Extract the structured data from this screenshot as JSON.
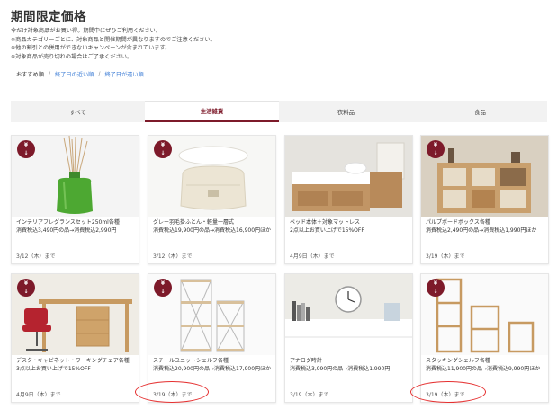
{
  "page": {
    "title": "期間限定価格",
    "notes": [
      "今だけ対象商品がお買い得。期間中にぜひご利用ください。",
      "※商品カテゴリーごとに、対象商品と開催期間が異なりますのでご注意ください。",
      "※他の割引との併用ができないキャンペーンが含まれています。",
      "※対象商品が売り切れの場合はご了承ください。"
    ]
  },
  "sort": {
    "active": "おすすめ順",
    "separator": "/",
    "options": [
      "終了日の近い順",
      "終了日が遠い順"
    ]
  },
  "tabs": [
    {
      "label": "すべて",
      "active": false
    },
    {
      "label": "生活雑貨",
      "active": true
    },
    {
      "label": "衣料品",
      "active": false
    },
    {
      "label": "食品",
      "active": false
    }
  ],
  "badge": {
    "symbol": "¥",
    "arrow": "↓"
  },
  "products": [
    {
      "name": "インテリアフレグランスセット250ml各種",
      "price": "消費税込3,490円の品→消費税込2,990円",
      "date": "3/12（木）まで"
    },
    {
      "name": "グレー羽毛掛ふとん・軽量一層式",
      "price": "消費税込19,900円の品→消費税込16,900円ほか",
      "date": "3/12（木）まで"
    },
    {
      "name": "ベッド本体＋対象マットレス",
      "price": "2点以上お買い上げで15%OFF",
      "date": "4月9日（木）まで"
    },
    {
      "name": "パルプボードボックス各種",
      "price": "消費税込2,490円の品→消費税込1,990円ほか",
      "date": "3/19（木）まで"
    },
    {
      "name": "デスク・キャビネット・ワーキングチェア各種",
      "price": "3点以上お買い上げで15%OFF",
      "date": "4月9日（木）まで"
    },
    {
      "name": "スチールユニットシェルフ各種",
      "price": "消費税込20,900円の品→消費税込17,900円ほか",
      "date": "3/19（木）まで"
    },
    {
      "name": "アナログ時計",
      "price": "消費税込3,990円の品→消費税込1,990円",
      "date": "3/19（木）まで"
    },
    {
      "name": "スタッキングシェルフ各種",
      "price": "消費税込11,900円の品→消費税込9,990円ほか",
      "date": "3/19（木）まで"
    }
  ],
  "colors": {
    "accent": "#7d1a2a",
    "link": "#3a7bd5",
    "annotation": "#e53030"
  }
}
